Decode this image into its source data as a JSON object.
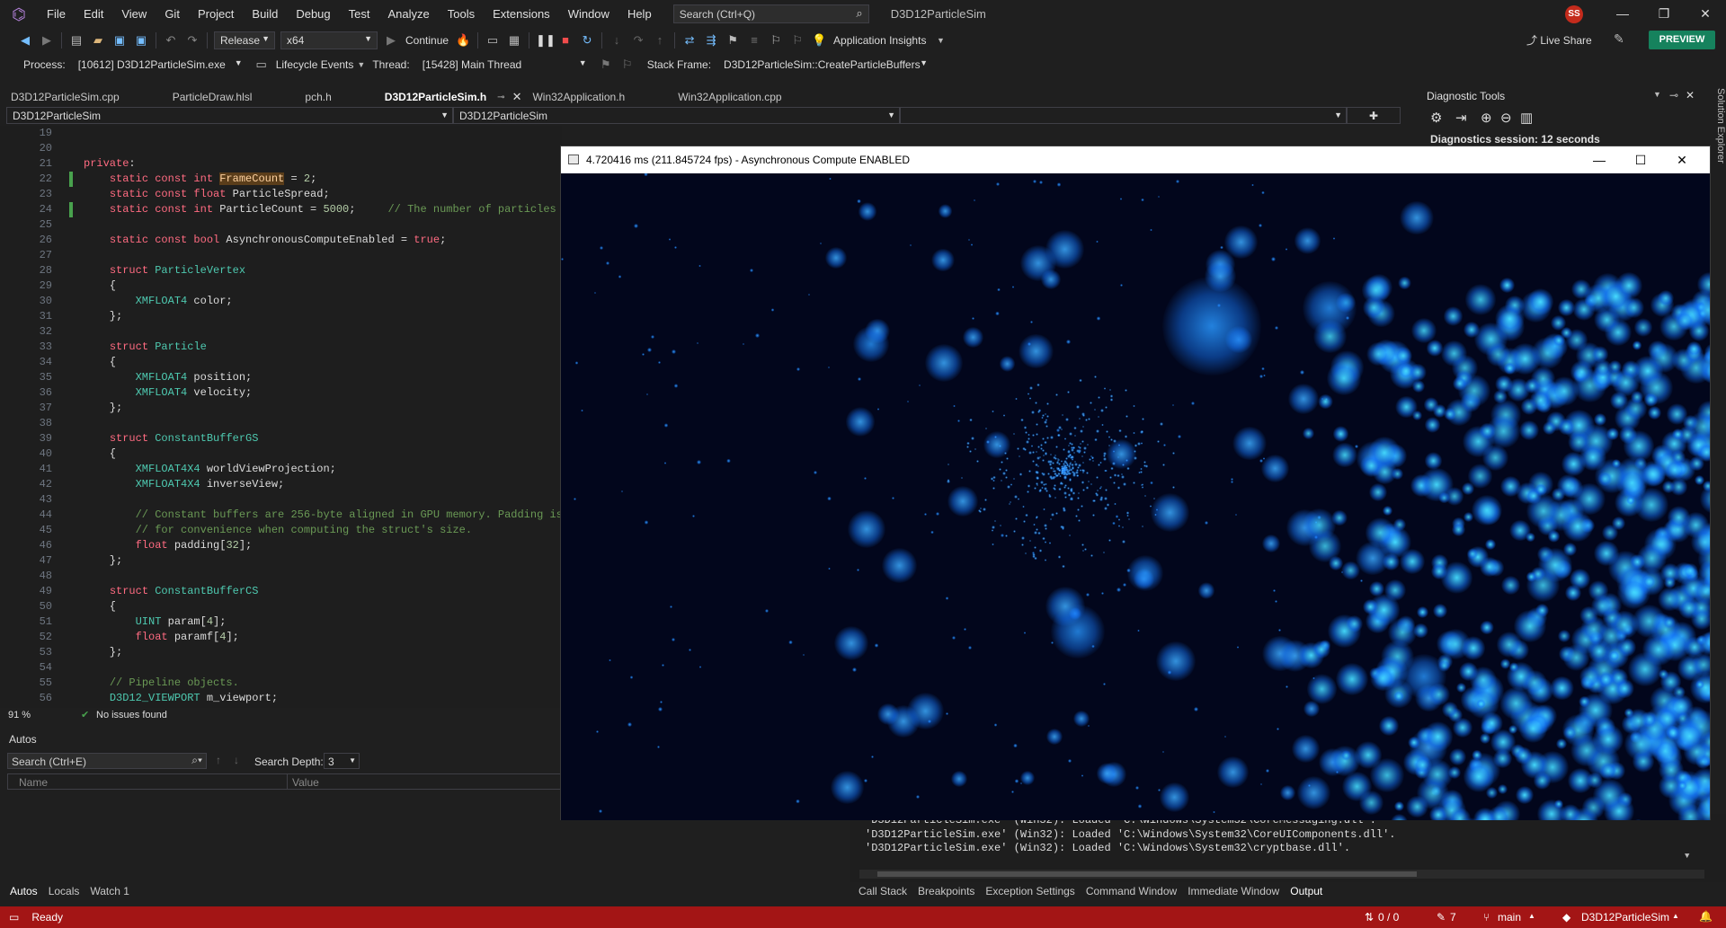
{
  "title_bar": {
    "menu": [
      "File",
      "Edit",
      "View",
      "Git",
      "Project",
      "Build",
      "Debug",
      "Test",
      "Analyze",
      "Tools",
      "Extensions",
      "Window",
      "Help"
    ],
    "search_placeholder": "Search (Ctrl+Q)",
    "solution_name": "D3D12ParticleSim",
    "avatar_initials": "SS"
  },
  "toolbar": {
    "configuration": "Release",
    "platform": "x64",
    "continue_label": "Continue",
    "app_insights_label": "Application Insights",
    "live_share_label": "Live Share",
    "preview_label": "PREVIEW"
  },
  "debug_bar": {
    "process_label": "Process:",
    "process_value": "[10612] D3D12ParticleSim.exe",
    "lifecycle_label": "Lifecycle Events",
    "thread_label": "Thread:",
    "thread_value": "[15428] Main Thread",
    "stack_frame_label": "Stack Frame:",
    "stack_frame_value": "D3D12ParticleSim::CreateParticleBuffers"
  },
  "doc_tabs": [
    {
      "label": "D3D12ParticleSim.cpp",
      "active": false
    },
    {
      "label": "ParticleDraw.hlsl",
      "active": false
    },
    {
      "label": "pch.h",
      "active": false
    },
    {
      "label": "D3D12ParticleSim.h",
      "active": true
    },
    {
      "label": "Win32Application.h",
      "active": false
    },
    {
      "label": "Win32Application.cpp",
      "active": false
    }
  ],
  "nav_bar": {
    "project": "D3D12ParticleSim",
    "scope": "D3D12ParticleSim",
    "member": ""
  },
  "editor": {
    "zoom": "91 %",
    "issues": "No issues found"
  },
  "autos": {
    "title": "Autos",
    "search_placeholder": "Search (Ctrl+E)",
    "search_depth_label": "Search Depth:",
    "search_depth_value": "3",
    "col_name": "Name",
    "col_value": "Value",
    "tabs": [
      "Autos",
      "Locals",
      "Watch 1"
    ]
  },
  "output": {
    "lines": [
      "'D3D12ParticleSim.exe' (Win32): Loaded 'C:\\Windows\\System32\\CoreMessaging.dll'.",
      "'D3D12ParticleSim.exe' (Win32): Loaded 'C:\\Windows\\System32\\CoreUIComponents.dll'.",
      "'D3D12ParticleSim.exe' (Win32): Loaded 'C:\\Windows\\System32\\cryptbase.dll'."
    ],
    "tabs": [
      "Call Stack",
      "Breakpoints",
      "Exception Settings",
      "Command Window",
      "Immediate Window",
      "Output"
    ]
  },
  "diagnostics": {
    "title": "Diagnostic Tools",
    "session": "Diagnostics session: 12 seconds",
    "side_tab": "Solution Explorer"
  },
  "app_window": {
    "title": "4.720416 ms (211.845724 fps) - Asynchronous Compute ENABLED"
  },
  "status_bar": {
    "state": "Ready",
    "changes": "0 / 0",
    "edits": "7",
    "branch": "main",
    "repo": "D3D12ParticleSim"
  },
  "colors": {
    "accent": "#75beff",
    "status_debug": "#a31515",
    "preview": "#16825d",
    "particle": "#1a8cff"
  }
}
